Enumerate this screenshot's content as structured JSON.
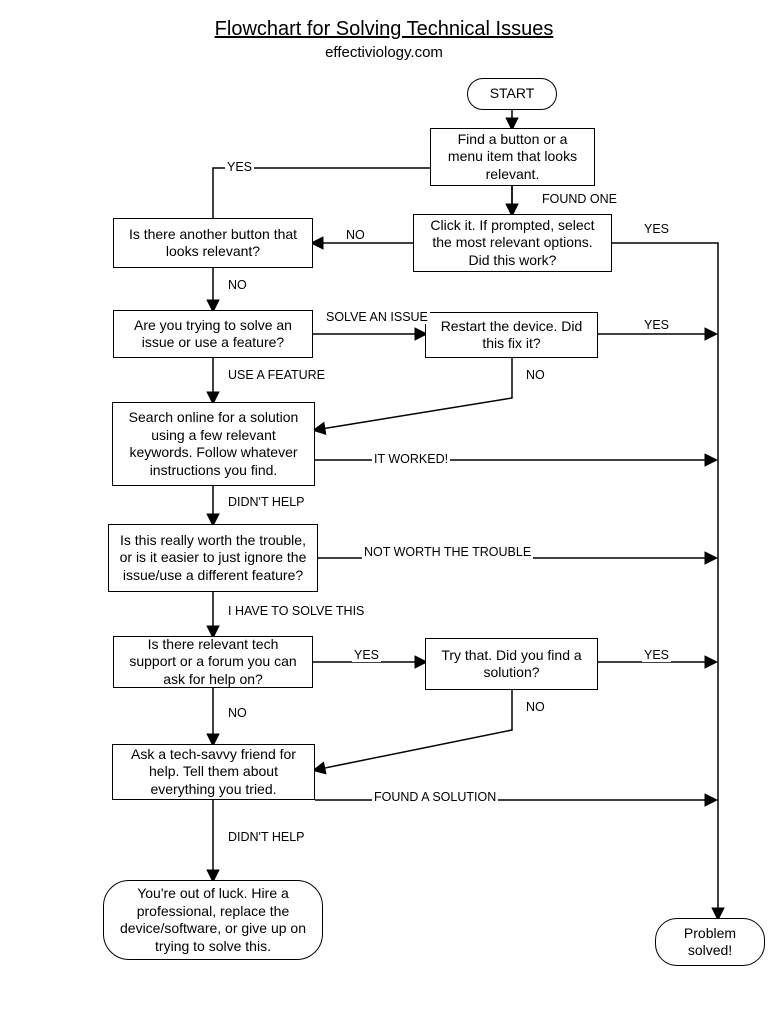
{
  "header": {
    "title": "Flowchart for Solving Technical Issues",
    "subtitle": "effectiviology.com"
  },
  "nodes": {
    "start": "START",
    "find_button": "Find a button or a menu item that looks relevant.",
    "click_it": "Click it. If prompted, select the most relevant options. Did this work?",
    "another_button": "Is there another button that looks relevant?",
    "issue_or_feature": "Are you trying to solve an issue or use a feature?",
    "restart": "Restart the device. Did this fix it?",
    "search_online": "Search online for a solution using a few relevant keywords. Follow whatever instructions you find.",
    "worth_it": "Is this really worth the trouble, or is it easier to just ignore the issue/use a different feature?",
    "tech_support": "Is there relevant tech support or a forum you can ask for help on?",
    "try_that": "Try that. Did you find a solution?",
    "ask_friend": "Ask a tech-savvy friend for help. Tell them about everything you tried.",
    "out_of_luck": "You're out of luck. Hire a professional, replace the device/software, or give up on trying to solve this.",
    "problem_solved": "Problem solved!"
  },
  "edges": {
    "found_one": "FOUND ONE",
    "yes": "YES",
    "no": "NO",
    "solve_issue": "SOLVE AN ISSUE",
    "use_feature": "USE A FEATURE",
    "it_worked": "IT WORKED!",
    "didnt_help": "DIDN'T HELP",
    "not_worth": "NOT WORTH THE TROUBLE",
    "have_to_solve": "I HAVE TO SOLVE THIS",
    "found_solution": "FOUND A SOLUTION"
  }
}
